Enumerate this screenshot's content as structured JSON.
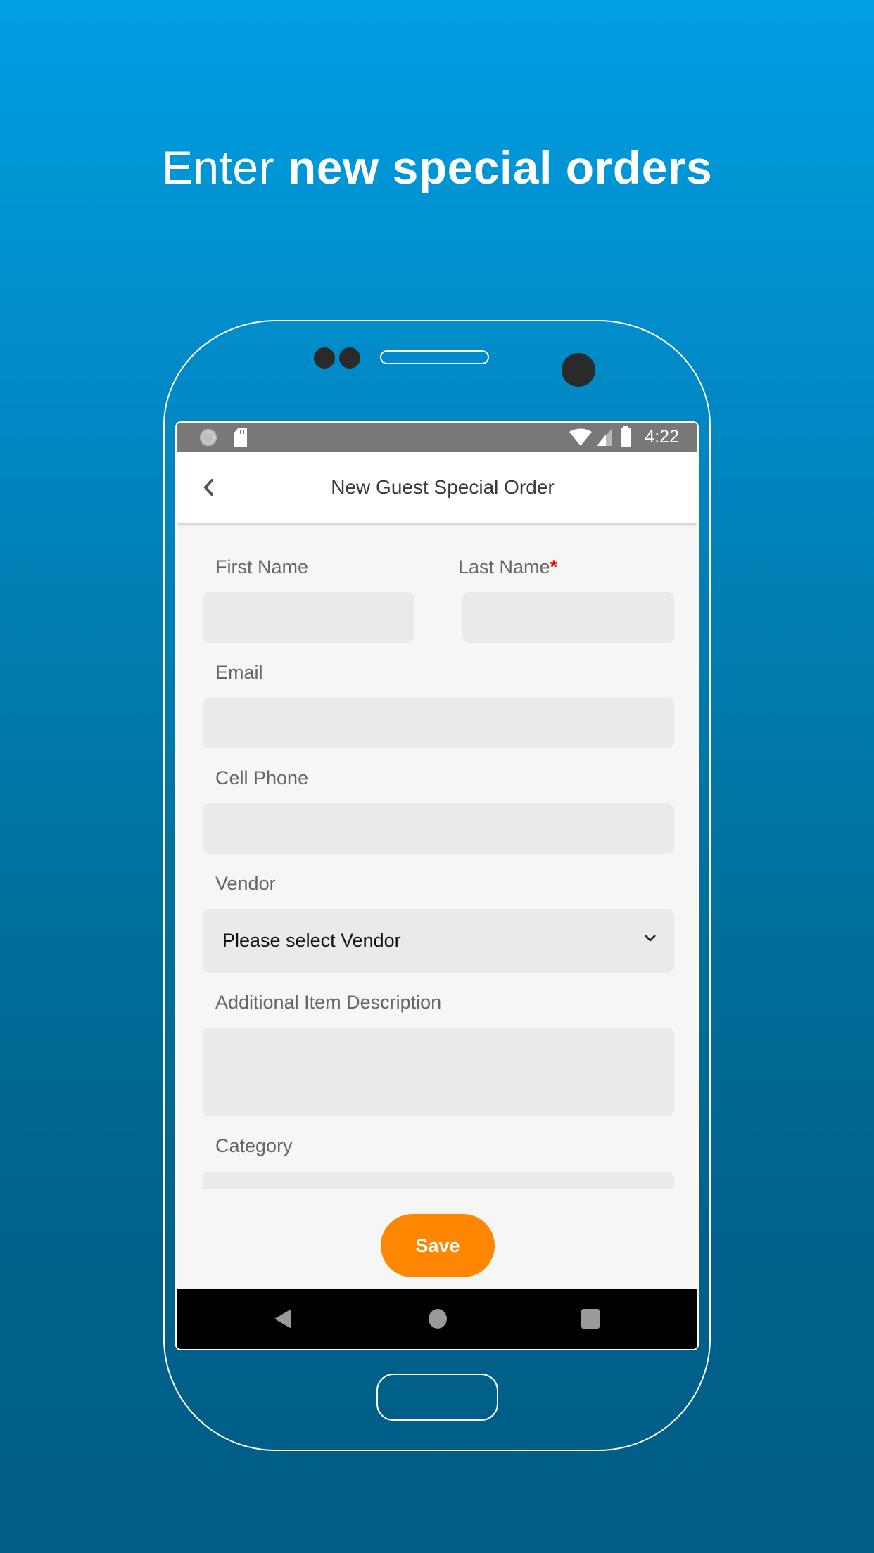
{
  "headline": {
    "light": "Enter ",
    "bold": "new special orders"
  },
  "status_bar": {
    "time": "4:22",
    "left_icons": [
      "sync-icon",
      "sd-card-icon"
    ],
    "right_icons": [
      "wifi-icon",
      "signal-icon",
      "battery-icon"
    ]
  },
  "app_bar": {
    "title": "New Guest Special Order",
    "back_icon": "chevron-left-icon"
  },
  "form": {
    "first_name": {
      "label": "First Name",
      "value": "",
      "required": false
    },
    "last_name": {
      "label": "Last Name",
      "required_marker": "*",
      "value": "",
      "required": true
    },
    "email": {
      "label": "Email",
      "value": ""
    },
    "cell_phone": {
      "label": "Cell Phone",
      "value": ""
    },
    "vendor": {
      "label": "Vendor",
      "selected": "Please select Vendor"
    },
    "description": {
      "label": "Additional Item Description",
      "value": ""
    },
    "category": {
      "label": "Category",
      "value": ""
    }
  },
  "save_label": "Save",
  "colors": {
    "accent": "#ff8600",
    "required": "#ee0000",
    "background_top": "#009fe3",
    "background_bottom": "#005d85"
  },
  "nav_bar": [
    "back-triangle-icon",
    "home-circle-icon",
    "recents-square-icon"
  ]
}
